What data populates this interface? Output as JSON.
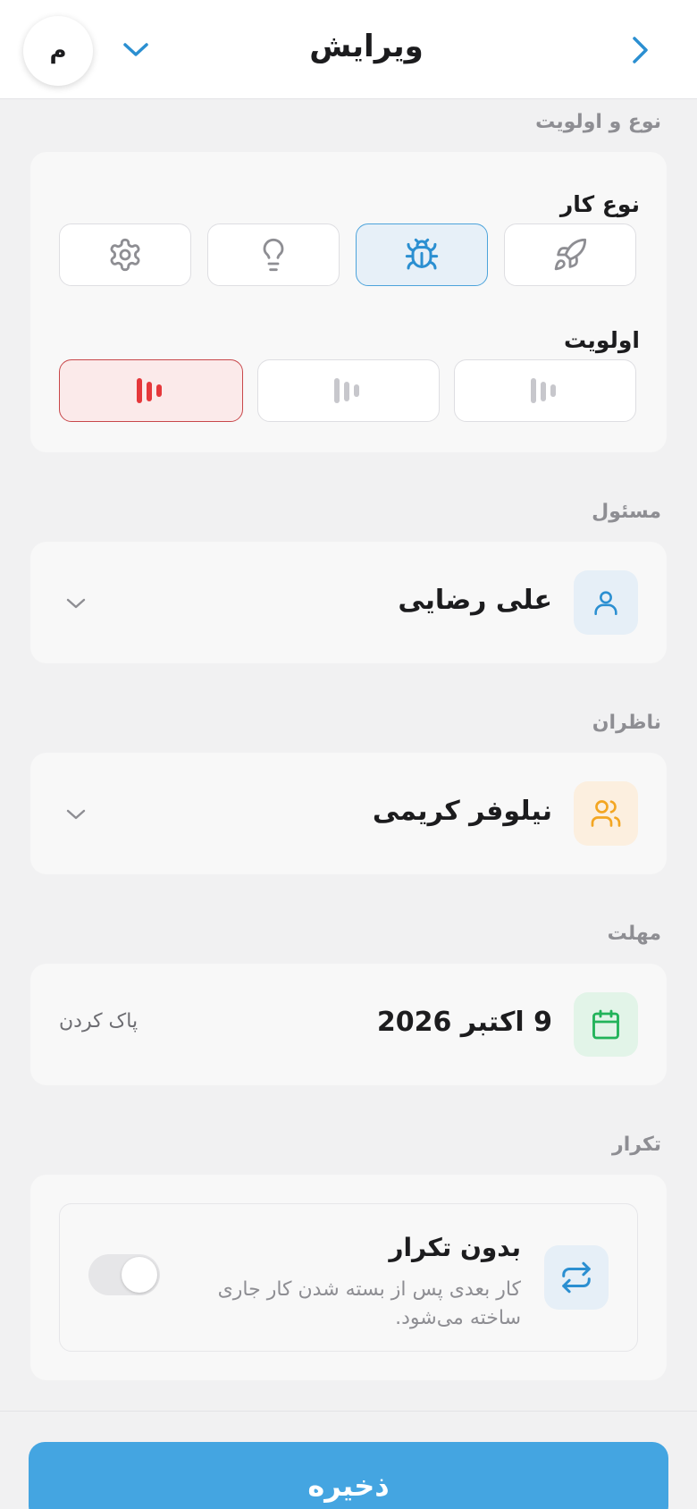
{
  "header": {
    "title": "ویرایش",
    "avatar_initial": "م"
  },
  "type_priority": {
    "section_label": "نوع و اولویت",
    "task_type_label": "نوع کار",
    "task_types": [
      {
        "icon": "rocket-icon",
        "selected": false
      },
      {
        "icon": "bug-icon",
        "selected": true
      },
      {
        "icon": "lightbulb-icon",
        "selected": false
      },
      {
        "icon": "gear-icon",
        "selected": false
      }
    ],
    "priority_label": "اولویت",
    "priorities": [
      {
        "icon": "priority-low-icon",
        "selected": false
      },
      {
        "icon": "priority-medium-icon",
        "selected": false
      },
      {
        "icon": "priority-high-icon",
        "selected": true
      }
    ]
  },
  "assignee": {
    "section_label": "مسئول",
    "name": "علی رضایی",
    "icon": "user-icon"
  },
  "watchers": {
    "section_label": "ناظران",
    "name": "نیلوفر کریمی",
    "icon": "users-icon"
  },
  "deadline": {
    "section_label": "مهلت",
    "date": "9 اکتبر 2026",
    "clear_label": "پاک کردن",
    "icon": "calendar-icon"
  },
  "repeat": {
    "section_label": "تکرار",
    "title": "بدون تکرار",
    "description": "کار بعدی پس از بسته شدن کار جاری ساخته می‌شود.",
    "icon": "repeat-icon",
    "enabled": false
  },
  "footer": {
    "save_label": "ذخیره"
  },
  "colors": {
    "accent_blue": "#44a5e1",
    "priority_red": "#e5383b",
    "watcher_orange": "#f3a623",
    "calendar_green": "#22b35a"
  }
}
